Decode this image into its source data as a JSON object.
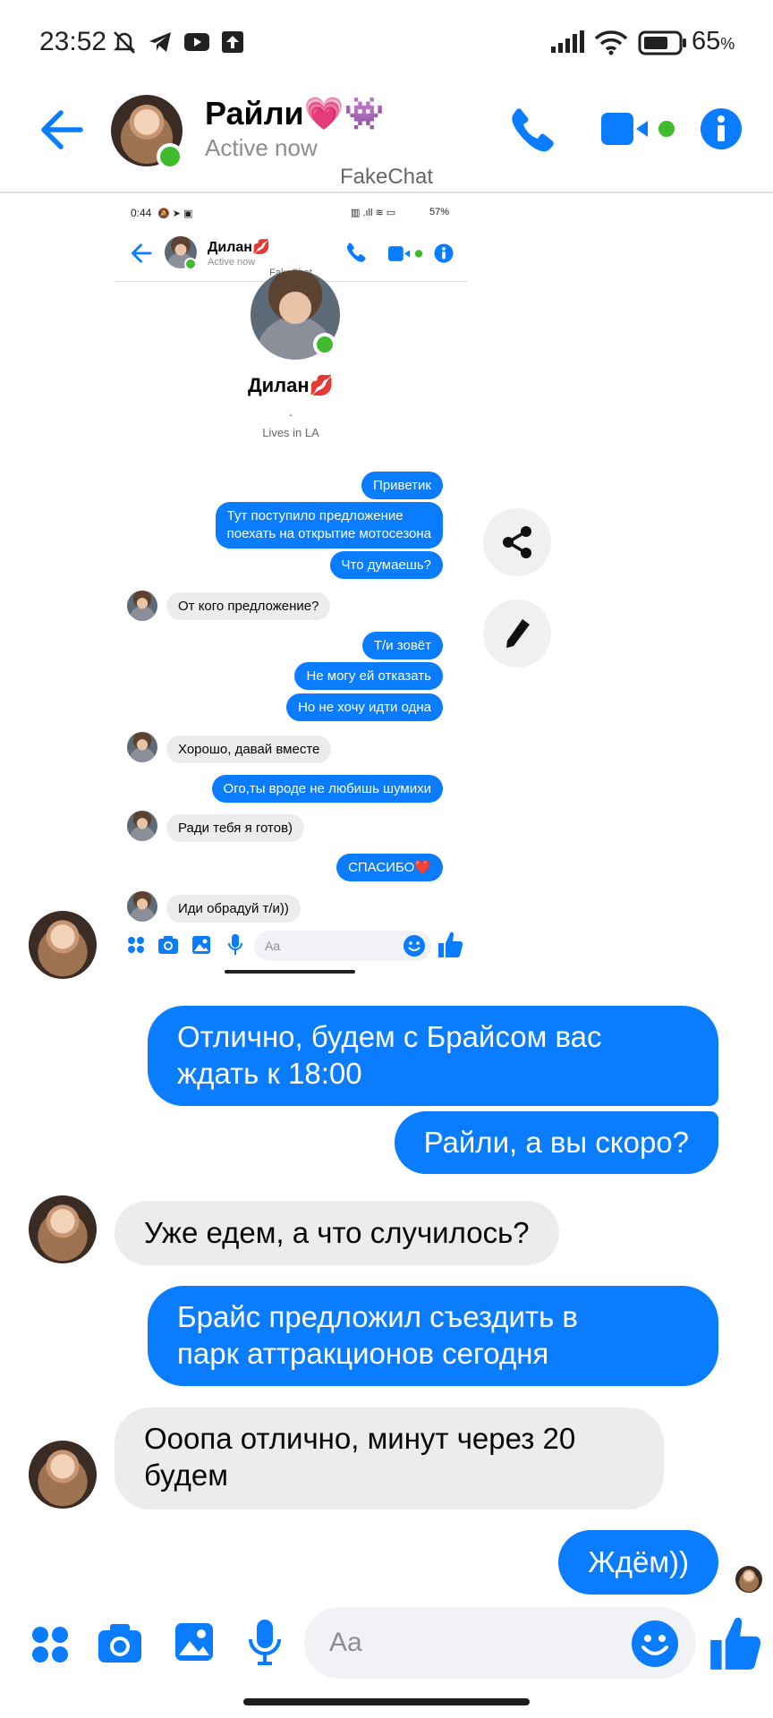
{
  "status_bar": {
    "time": "23:52",
    "battery": "65",
    "battery_unit": "%"
  },
  "header": {
    "contact_name": "Райли💗👾",
    "status": "Active now",
    "watermark": "FakeChat"
  },
  "embedded_screenshot": {
    "status_time": "0:44",
    "status_battery": "57%",
    "contact_name": "Дилан💋",
    "status": "Active now",
    "watermark": "FakeChat",
    "profile_name": "Дилан💋",
    "profile_dot": ".",
    "profile_location": "Lives in LA",
    "input_placeholder": "Aa",
    "messages": [
      {
        "side": "out",
        "text": "Приветик"
      },
      {
        "side": "out",
        "text": "Тут поступило предложение\nпоехать на открытие мотосезона"
      },
      {
        "side": "out",
        "text": "Что думаешь?"
      },
      {
        "side": "in",
        "text": "От кого предложение?"
      },
      {
        "side": "out",
        "text": "Т/и зовёт"
      },
      {
        "side": "out",
        "text": "Не могу ей отказать"
      },
      {
        "side": "out",
        "text": "Но не хочу идти одна"
      },
      {
        "side": "in",
        "text": "Хорошо, давай вместе"
      },
      {
        "side": "out",
        "text": "Ого,ты вроде не любишь шумихи"
      },
      {
        "side": "in",
        "text": "Ради тебя я готов)"
      },
      {
        "side": "out",
        "text": "СПАСИБО❤️"
      },
      {
        "side": "in",
        "text": "Иди обрадуй т/и))"
      }
    ]
  },
  "messages": [
    {
      "side": "out",
      "text": "Отлично, будем с Брайсом вас\nждать к 18:00"
    },
    {
      "side": "out",
      "text": "Райли, а вы скоро?"
    },
    {
      "side": "in",
      "text": "Уже едем, а что случилось?"
    },
    {
      "side": "out",
      "text": "Брайс предложил съездить в\nпарк аттракционов сегодня"
    },
    {
      "side": "in",
      "text": "Ооопа отлично, минут через 20\nбудем"
    },
    {
      "side": "out",
      "text": "Ждём))"
    }
  ],
  "composer": {
    "placeholder": "Aa"
  },
  "colors": {
    "accent": "#0a7cff",
    "online": "#3fbb2d",
    "incoming_bubble": "#ececec"
  },
  "icons": [
    "back-arrow-icon",
    "phone-icon",
    "video-camera-icon",
    "info-icon",
    "share-icon",
    "pencil-icon",
    "apps-grid-icon",
    "camera-icon",
    "gallery-icon",
    "microphone-icon",
    "emoji-icon",
    "thumbs-up-icon"
  ]
}
